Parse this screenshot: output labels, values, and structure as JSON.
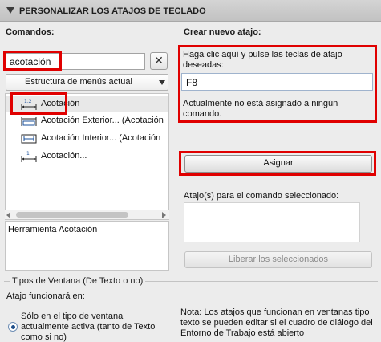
{
  "header": {
    "title": "PERSONALIZAR LOS ATAJOS DE TECLADO"
  },
  "commands": {
    "label": "Comandos:",
    "search_value": "acotación",
    "clear_button": "✕",
    "dropdown_selected": "Estructura de menús actual",
    "items": [
      {
        "label": "Acotación",
        "icon": "linear-dimension-icon",
        "selected": true
      },
      {
        "label": "Acotación Exterior... (Acotación",
        "icon": "exterior-dimension-icon",
        "selected": false
      },
      {
        "label": "Acotación Interior... (Acotación",
        "icon": "interior-dimension-icon",
        "selected": false
      },
      {
        "label": "Acotación...",
        "icon": "dimension-settings-icon",
        "selected": false
      }
    ],
    "description": "Herramienta Acotación"
  },
  "new_shortcut": {
    "label": "Crear nuevo atajo:",
    "hint": "Haga clic aquí y pulse las teclas de atajo deseadas:",
    "key_value": "F8",
    "status": "Actualmente no está asignado a ningún comando.",
    "assign_button": "Asignar",
    "assigned_label": "Atajo(s) para el comando seleccionado:",
    "release_button": "Liberar los seleccionados"
  },
  "window_types": {
    "title": "Tipos de Ventana (De Texto o no)",
    "works_label": "Atajo funcionará en:",
    "radio_label": "Sólo en el tipo de ventana actualmente activa (tanto de Texto como si no)",
    "note": "Nota: Los atajos que funcionan en ventanas tipo texto se pueden editar si el cuadro de diálogo del Entorno de Trabajo está abierto"
  },
  "colors": {
    "highlight": "#e00000",
    "header_bg": "#c8c8c8",
    "panel_bg": "#ececec"
  }
}
